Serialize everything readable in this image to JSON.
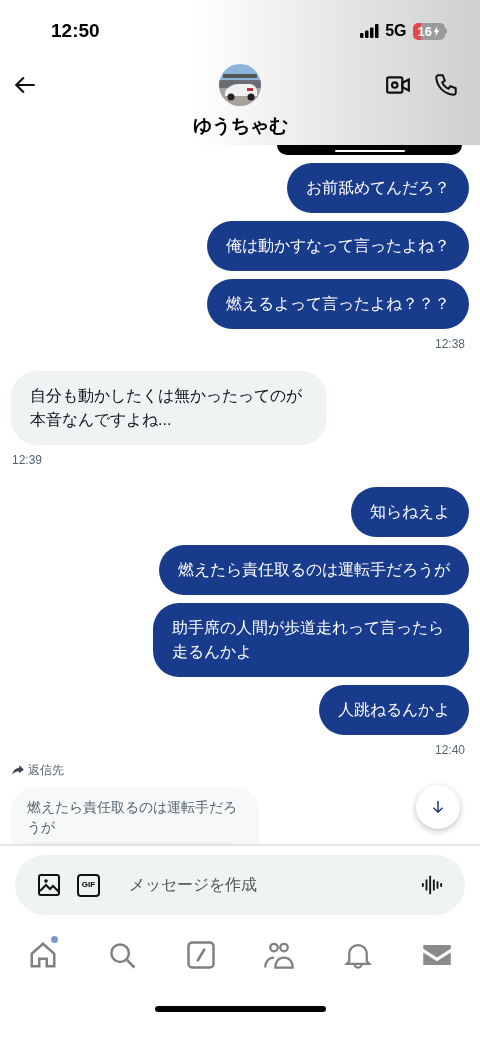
{
  "status_bar": {
    "time": "12:50",
    "network": "5G",
    "battery": "16"
  },
  "header": {
    "name": "ゆうちゃむ"
  },
  "groups": [
    {
      "kind": "sent",
      "bubbles": [
        "お前舐めてんだろ？",
        "俺は動かすなって言ったよね？",
        "燃えるよって言ったよね？？？"
      ],
      "time": "12:38"
    },
    {
      "kind": "received",
      "bubbles": [
        "自分も動かしたくは無かったってのが本音なんですよね..."
      ],
      "time": "12:39"
    },
    {
      "kind": "sent",
      "bubbles": [
        "知らねえよ",
        "燃えたら責任取るのは運転手だろうが",
        "助手席の人間が歩道走れって言ったら走るんかよ",
        "人跳ねるんかよ"
      ],
      "time": "12:40"
    }
  ],
  "reply": {
    "label": "返信先",
    "quoted": "燃えたら責任取るのは運転手だろうが"
  },
  "composer": {
    "gif": "GIF",
    "placeholder": "メッセージを作成"
  },
  "nav": [
    {
      "kind": "home",
      "selected": false,
      "badge": true
    },
    {
      "kind": "search",
      "selected": false,
      "badge": false
    },
    {
      "kind": "compose",
      "selected": false,
      "badge": false
    },
    {
      "kind": "people",
      "selected": false,
      "badge": false
    },
    {
      "kind": "bell",
      "selected": false,
      "badge": false
    },
    {
      "kind": "mail",
      "selected": true,
      "badge": false
    }
  ]
}
